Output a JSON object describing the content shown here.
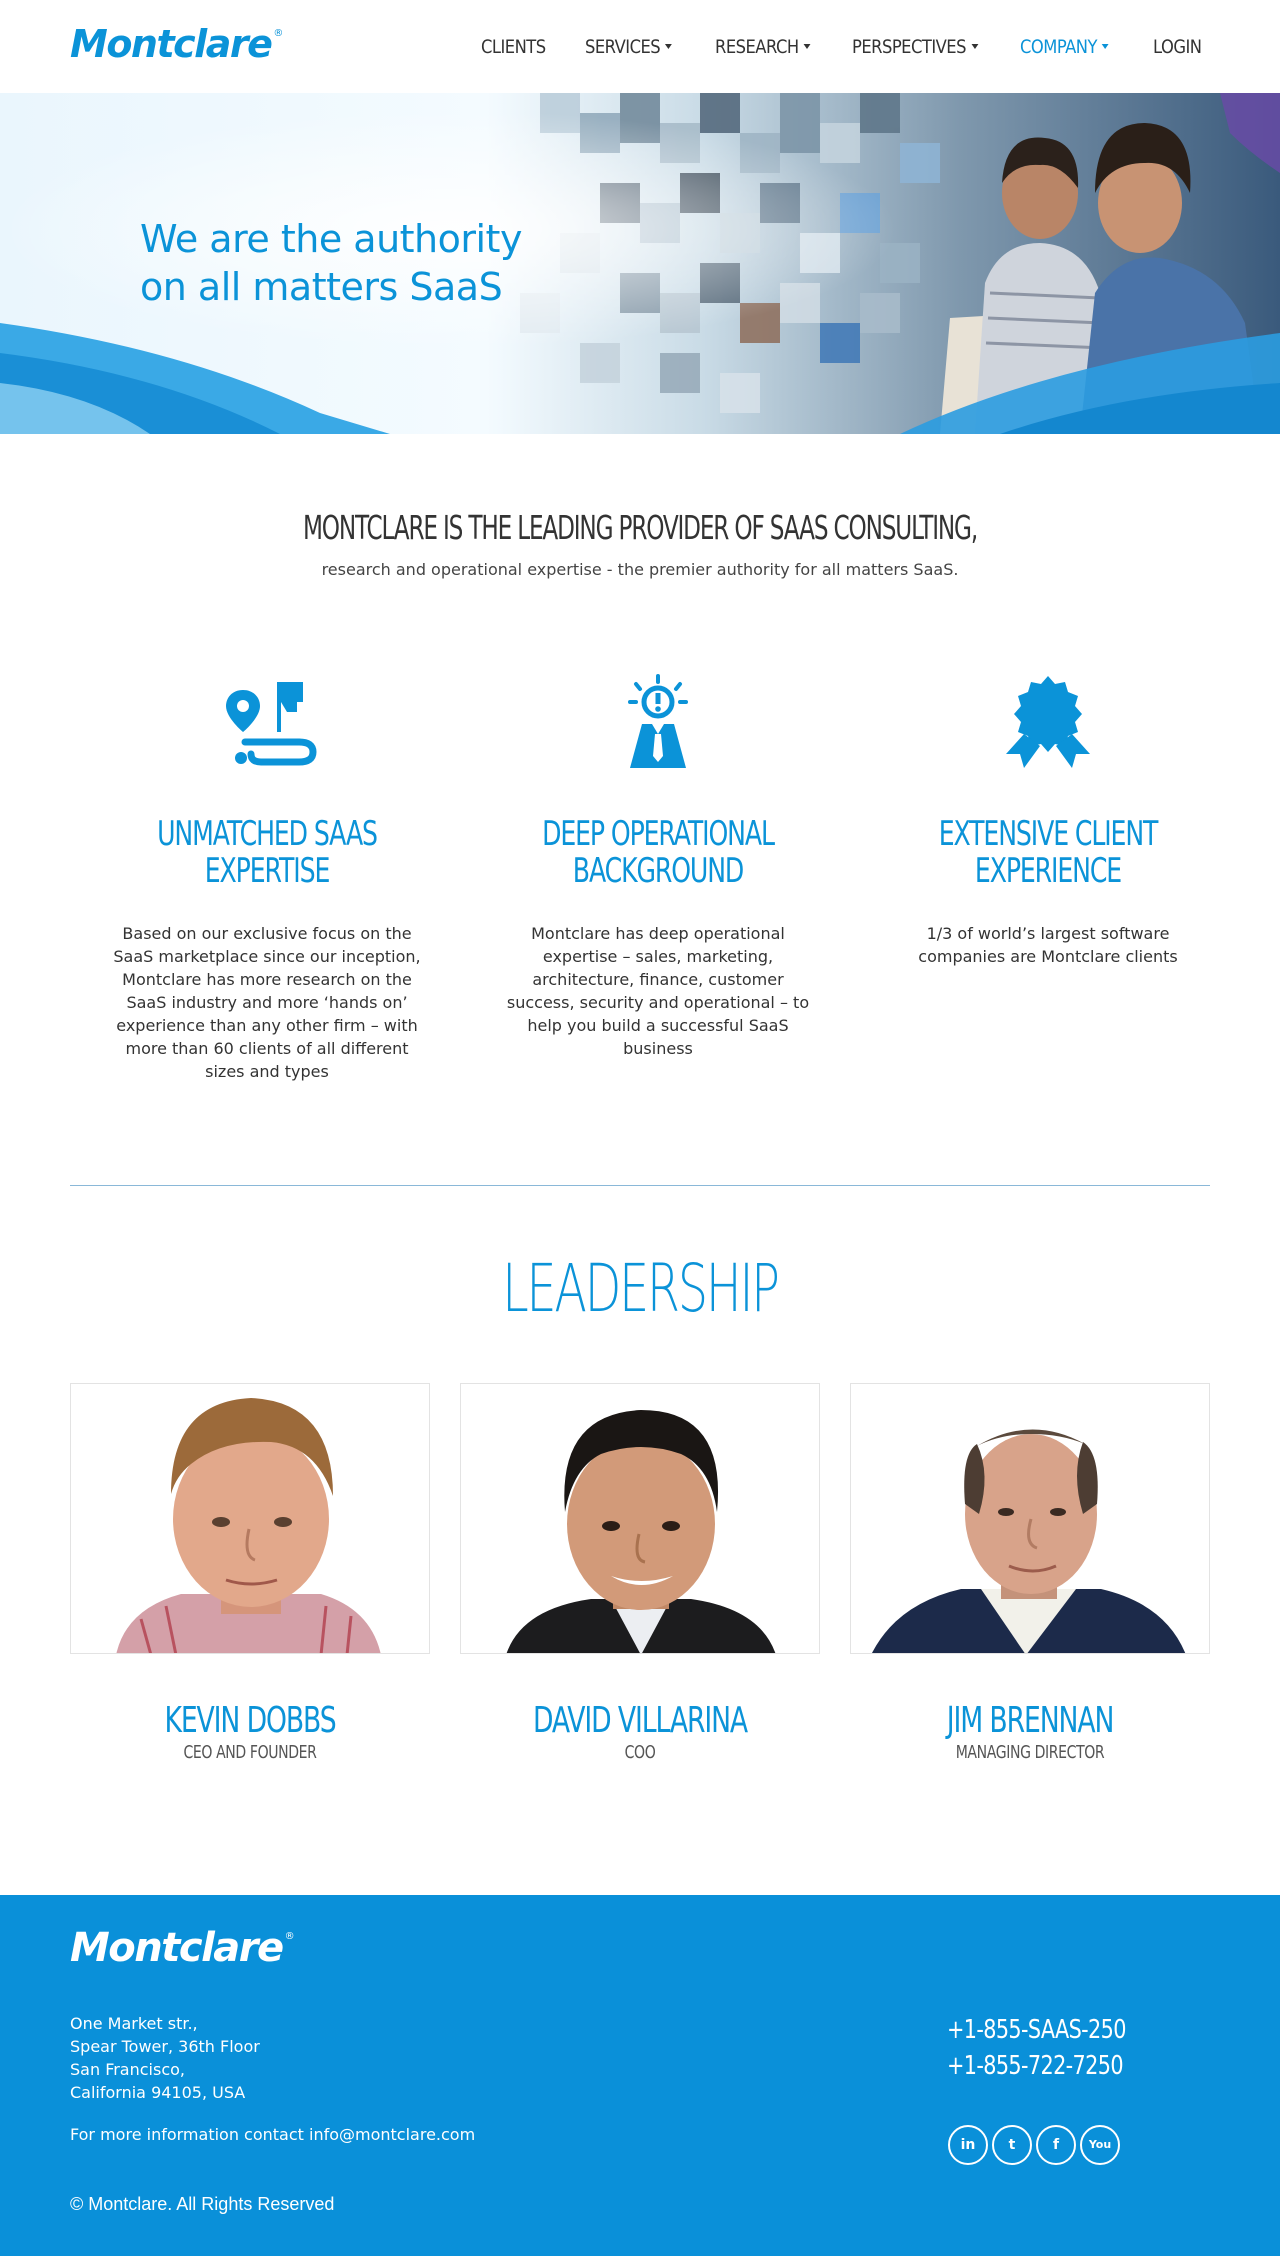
{
  "header": {
    "logo": "Montclare",
    "logo_mark": "®",
    "nav": [
      {
        "label": "CLIENTS",
        "dropdown": false,
        "active": false
      },
      {
        "label": "SERVICES",
        "dropdown": true,
        "active": false
      },
      {
        "label": "RESEARCH",
        "dropdown": true,
        "active": false
      },
      {
        "label": "PERSPECTIVES",
        "dropdown": true,
        "active": false
      },
      {
        "label": "COMPANY",
        "dropdown": true,
        "active": true
      },
      {
        "label": "LOGIN",
        "dropdown": false,
        "active": false
      }
    ]
  },
  "hero": {
    "line1": "We are the authority",
    "line2": "on all matters SaaS"
  },
  "intro": {
    "heading": "MONTCLARE IS THE LEADING PROVIDER OF SAAS CONSULTING,",
    "subheading": "research and operational expertise - the premier authority for all matters SaaS."
  },
  "features": [
    {
      "icon": "roadmap-icon",
      "title": "UNMATCHED SAAS\nEXPERTISE",
      "description": "Based on our exclusive focus on the SaaS marketplace since our inception, Montclare has more research on the SaaS industry and more ‘hands on’ experience than any other firm – with more than 60 clients of all different sizes and types"
    },
    {
      "icon": "idea-person-icon",
      "title": "DEEP OPERATIONAL\nBACKGROUND",
      "description": "Montclare has deep operational expertise – sales, marketing, architecture, finance, customer success, security and operational – to help you build a successful SaaS business"
    },
    {
      "icon": "award-ribbon-icon",
      "title": "EXTENSIVE CLIENT\nEXPERIENCE",
      "description": "1/3 of world’s largest software companies are Montclare clients"
    }
  ],
  "leadership": {
    "title": "LEADERSHIP",
    "people": [
      {
        "name": "KEVIN DOBBS",
        "role": "CEO AND FOUNDER"
      },
      {
        "name": "DAVID VILLARINA",
        "role": "COO"
      },
      {
        "name": "JIM BRENNAN",
        "role": "MANAGING DIRECTOR"
      }
    ]
  },
  "footer": {
    "logo": "Montclare",
    "logo_mark": "®",
    "address": [
      "One Market str.,",
      "Spear Tower, 36th Floor",
      "San Francisco,",
      "California 94105, USA"
    ],
    "contact": "For more information contact info@montclare.com",
    "copyright": "© Montclare. All Rights Reserved",
    "phones": [
      "+1-855-SAAS-250",
      "+1-855-722-7250"
    ],
    "social": [
      {
        "icon": "linkedin-icon",
        "glyph": "in"
      },
      {
        "icon": "twitter-icon",
        "glyph": "t"
      },
      {
        "icon": "facebook-icon",
        "glyph": "f"
      },
      {
        "icon": "youtube-icon",
        "glyph": "You"
      }
    ]
  },
  "colors": {
    "brand": "#0b93d8",
    "footer_bg": "#0a90d9",
    "text": "#333333"
  }
}
